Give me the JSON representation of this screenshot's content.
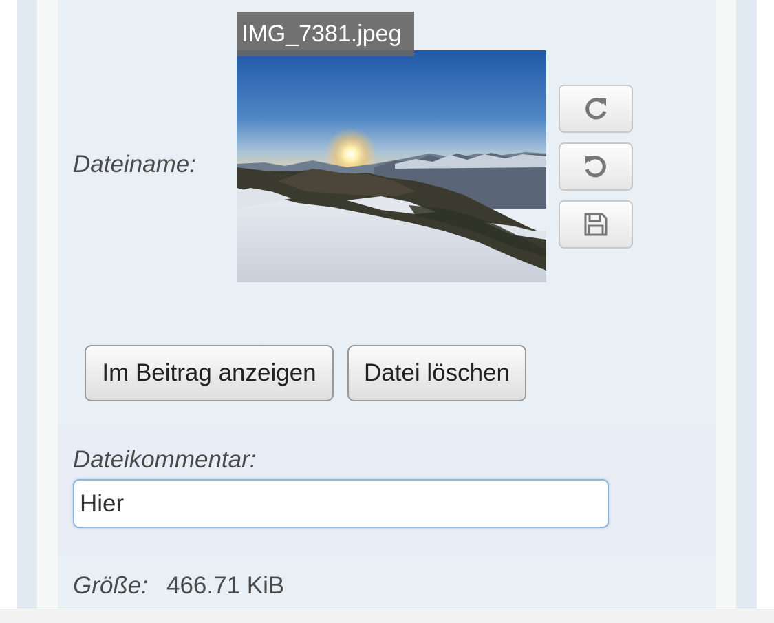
{
  "file": {
    "name": "IMG_7381.jpeg",
    "filename_label": "Dateiname:",
    "size_label": "Größe:",
    "size_value": "466.71 KiB"
  },
  "image_tools": [
    {
      "icon": "rotate-clockwise-icon"
    },
    {
      "icon": "rotate-counterclockwise-icon"
    },
    {
      "icon": "floppy-disk-save-icon"
    }
  ],
  "actions": {
    "show_in_post": "Im Beitrag anzeigen",
    "delete_file": "Datei löschen"
  },
  "comment": {
    "label": "Dateikommentar:",
    "value": "Hier"
  },
  "colors": {
    "panel": "#e9f0f5",
    "outer": "#e1e9f3",
    "input_border": "#93b6d8"
  }
}
